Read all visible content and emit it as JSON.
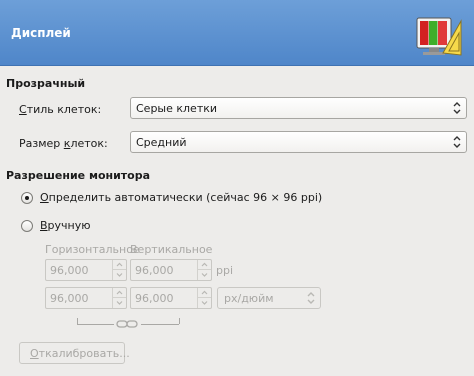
{
  "header": {
    "title": "Дисплей",
    "icon": "display-settings-icon"
  },
  "transparency": {
    "title": "Прозрачный",
    "check_style": {
      "label_pre": "",
      "label_mnemonic": "С",
      "label_post": "тиль клеток:",
      "value": "Серые клетки"
    },
    "check_size": {
      "label_pre": "Размер ",
      "label_mnemonic": "к",
      "label_post": "леток:",
      "value": "Средний"
    }
  },
  "resolution": {
    "title": "Разрешение монитора",
    "auto": {
      "label_pre": "",
      "label_mnemonic": "О",
      "label_post": "пределить автоматически (сейчас 96 × 96 ppi)",
      "selected": true
    },
    "manual": {
      "label_pre": "",
      "label_mnemonic": "В",
      "label_post": "ручную",
      "selected": false,
      "horizontal_label": "Горизонтальное",
      "vertical_label": "Вертикальное",
      "horizontal_value": "96,000",
      "vertical_value": "96,000",
      "ppi_label": "ppi",
      "x_value": "96,000",
      "y_value": "96,000",
      "unit_value": "px/дюйм"
    },
    "calibrate": {
      "label_pre": "",
      "label_mnemonic": "О",
      "label_post": "ткалибровать..."
    }
  },
  "colors": {
    "header_bg": "#5a8fce",
    "disabled_text": "#a9a8a5"
  }
}
